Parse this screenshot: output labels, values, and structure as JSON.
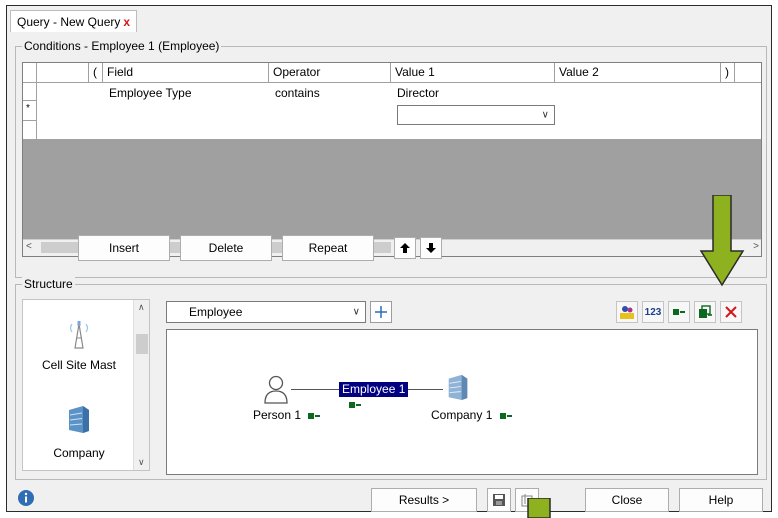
{
  "tab": {
    "title": "Query - New Query",
    "close": "x"
  },
  "conditions": {
    "legend": "Conditions - Employee 1 (Employee)",
    "columns": [
      "(",
      "Field",
      "Operator",
      "Value 1",
      "Value 2",
      ")"
    ],
    "rows": [
      {
        "field": "Employee Type",
        "operator": "contains",
        "value1": "Director",
        "value2": ""
      }
    ],
    "new_row_marker": "*"
  },
  "buttons": {
    "insert": "Insert",
    "delete": "Delete",
    "repeat": "Repeat",
    "results": "Results >",
    "close": "Close",
    "help": "Help"
  },
  "structure": {
    "legend": "Structure",
    "palette": [
      "Cell Site Mast",
      "Company"
    ],
    "entity_select": "Employee",
    "toolbar_number_label": "123",
    "nodes": {
      "person": "Person 1",
      "link": "Employee 1",
      "company": "Company 1"
    }
  },
  "colors": {
    "arrow": "#8db11f",
    "highlight": "#000080",
    "close_red": "#d4161b"
  }
}
